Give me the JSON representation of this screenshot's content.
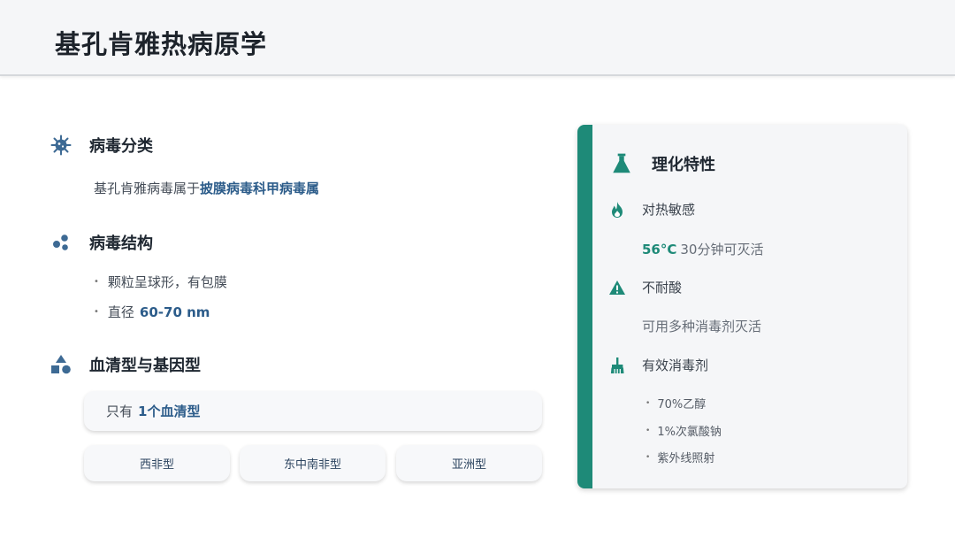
{
  "page": {
    "title": "基孔肯雅热病原学"
  },
  "classification": {
    "heading": "病毒分类",
    "text_prefix": "基孔肯雅病毒属于",
    "text_highlight": "披膜病毒科甲病毒属"
  },
  "structure": {
    "heading": "病毒结构",
    "bullets": [
      {
        "text": "颗粒呈球形，有包膜",
        "highlight": ""
      },
      {
        "text": "直径",
        "highlight": "60-70 nm"
      }
    ]
  },
  "serotype": {
    "heading": "血清型与基因型",
    "main_prefix": "只有",
    "main_highlight": "1个血清型",
    "genotypes": [
      "西非型",
      "东中南非型",
      "亚洲型"
    ]
  },
  "card": {
    "title": "理化特性",
    "heat": {
      "label": "对热敏感",
      "value": "56°C",
      "detail": "30分钟可灭活"
    },
    "acid": {
      "label": "不耐酸",
      "detail": "可用多种消毒剂灭活"
    },
    "disinfectant": {
      "label": "有效消毒剂",
      "items": [
        "70%乙醇",
        "1%次氯酸钠",
        "紫外线照射"
      ]
    }
  },
  "colors": {
    "accent_blue": "#2c5c8a",
    "accent_teal": "#1e8a78",
    "icon_blue": "#3d6a94"
  },
  "icons": [
    "virus-icon",
    "molecule-icon",
    "shapes-icon",
    "flask-icon",
    "fire-icon",
    "warning-icon",
    "broom-icon"
  ]
}
